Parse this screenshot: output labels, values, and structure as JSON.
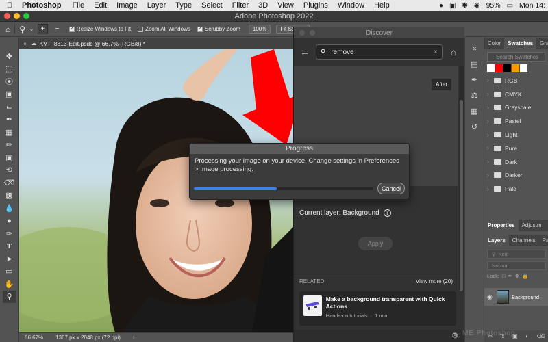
{
  "menubar": {
    "app_name": "Photoshop",
    "items": [
      "File",
      "Edit",
      "Image",
      "Layer",
      "Type",
      "Select",
      "Filter",
      "3D",
      "View",
      "Plugins",
      "Window",
      "Help"
    ],
    "battery": "95%",
    "clock": "Mon 14:"
  },
  "window": {
    "title": "Adobe Photoshop 2022"
  },
  "options": {
    "resize_windows": "Resize Windows to Fit",
    "zoom_all": "Zoom All Windows",
    "scrubby_zoom": "Scrubby Zoom",
    "zoom_pct": "100%",
    "fit_screen": "Fit Screen",
    "resize_checked": true,
    "zoom_all_checked": false,
    "scrubby_checked": true
  },
  "document": {
    "tab_title": "KVT_8813-Edit.psdc @ 66.7% (RGB/8) *"
  },
  "statusbar": {
    "zoom": "66.67%",
    "info": "1367 px x 2048 px (72 ppi)"
  },
  "discover": {
    "title": "Discover",
    "search_value": "remove",
    "after_label": "After",
    "current_layer": "Current layer: Background",
    "apply_label": "Apply",
    "related_label": "RELATED",
    "view_more": "View more (20)",
    "card_title": "Make a background transparent with Quick Actions",
    "card_source": "Hands-on tutorials",
    "card_duration": "1 min"
  },
  "progress": {
    "title": "Progress",
    "message": "Processing your image on your device. Change settings in Preferences > Image processing.",
    "fraction": 0.46,
    "cancel_label": "Cancel"
  },
  "swatches": {
    "tabs": [
      "Color",
      "Swatches",
      "Grad"
    ],
    "search_placeholder": "Search Swatches",
    "recent": [
      "#ffffff",
      "#ff0000",
      "#000000",
      "#ff9900",
      "#ffffff"
    ],
    "folders": [
      "RGB",
      "CMYK",
      "Grayscale",
      "Pastel",
      "Light",
      "Pure",
      "Dark",
      "Darker",
      "Pale"
    ]
  },
  "properties": {
    "tabs": [
      "Properties",
      "Adjustm"
    ]
  },
  "layers": {
    "tabs": [
      "Layers",
      "Channels",
      "Pa"
    ],
    "kind_placeholder": "Kind",
    "blend_mode": "Normal",
    "lock_label": "Lock:",
    "layer_name": "Background"
  },
  "watermark": "ME Photoshop"
}
